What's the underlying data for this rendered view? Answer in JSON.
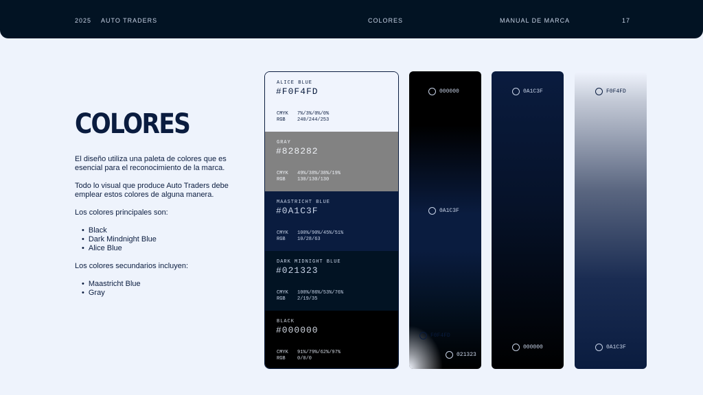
{
  "header": {
    "year": "2025",
    "brand": "AUTO TRADERS",
    "section": "COLORES",
    "doc": "MANUAL DE MARCA",
    "page": "17"
  },
  "title": "COLORES",
  "intro": "El diseño utiliza una paleta de colores que es esencial para el reconocimiento de la marca.",
  "intro2": "Todo lo visual que produce Auto Traders debe emplear estos colores de alguna manera.",
  "primary_heading": "Los colores principales son:",
  "primary": [
    "Black",
    "Dark Mindnight Blue",
    "Alice Blue"
  ],
  "secondary_heading": "Los colores secundarios incluyen:",
  "secondary": [
    "Maastricht Blue",
    "Gray"
  ],
  "swatches": [
    {
      "name": "ALICE BLUE",
      "hex": "#F0F4FD",
      "cmyk": "7%/3%/0%/0%",
      "rgb": "240/244/253",
      "bg": "#f0f4fd",
      "fg": "#0a1c3f"
    },
    {
      "name": "GRAY",
      "hex": "#828282",
      "cmyk": "49%/38%/38%/19%",
      "rgb": "130/130/130",
      "bg": "#828282",
      "fg": "#eef1f6"
    },
    {
      "name": "MAASTRICHT BLUE",
      "hex": "#0A1C3F",
      "cmyk": "100%/90%/45%/51%",
      "rgb": "10/28/63",
      "bg": "#0a1c3f",
      "fg": "#c9d4e8"
    },
    {
      "name": "DARK MIDNIGHT BLUE",
      "hex": "#021323",
      "cmyk": "100%/86%/53%/76%",
      "rgb": "2/19/35",
      "bg": "#021323",
      "fg": "#c9d4e8"
    },
    {
      "name": "BLACK",
      "hex": "#000000",
      "cmyk": "91%/79%/62%/97%",
      "rgb": "0/0/0",
      "bg": "#000000",
      "fg": "#d0d6e0"
    }
  ],
  "cmyk_label": "CMYK",
  "rgb_label": "RGB",
  "gradients": {
    "g1": [
      "000000",
      "0A1C3F",
      "F0F4FD",
      "021323"
    ],
    "g2": [
      "0A1C3F",
      "000000"
    ],
    "g3": [
      "F0F4FD",
      "0A1C3F"
    ]
  },
  "colors": {
    "black": "#000000",
    "maastricht": "#0a1c3f",
    "midnight": "#021323",
    "alice": "#f0f4fd",
    "gray": "#828282"
  }
}
